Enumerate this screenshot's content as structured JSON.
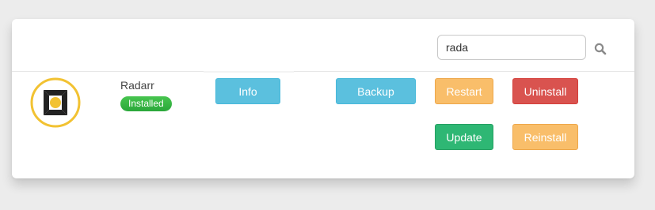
{
  "search": {
    "value": "rada"
  },
  "app": {
    "name": "Radarr",
    "status": "Installed"
  },
  "buttons": {
    "info": "Info",
    "backup": "Backup",
    "restart": "Restart",
    "uninstall": "Uninstall",
    "update": "Update",
    "reinstall": "Reinstall"
  },
  "icons": {
    "search": "search-icon",
    "logo": "radarr-logo"
  },
  "colors": {
    "info": "#5bc0de",
    "warning": "#f9be6a",
    "danger": "#d9534f",
    "success": "#2eb774",
    "badge": "#2fae3d"
  }
}
